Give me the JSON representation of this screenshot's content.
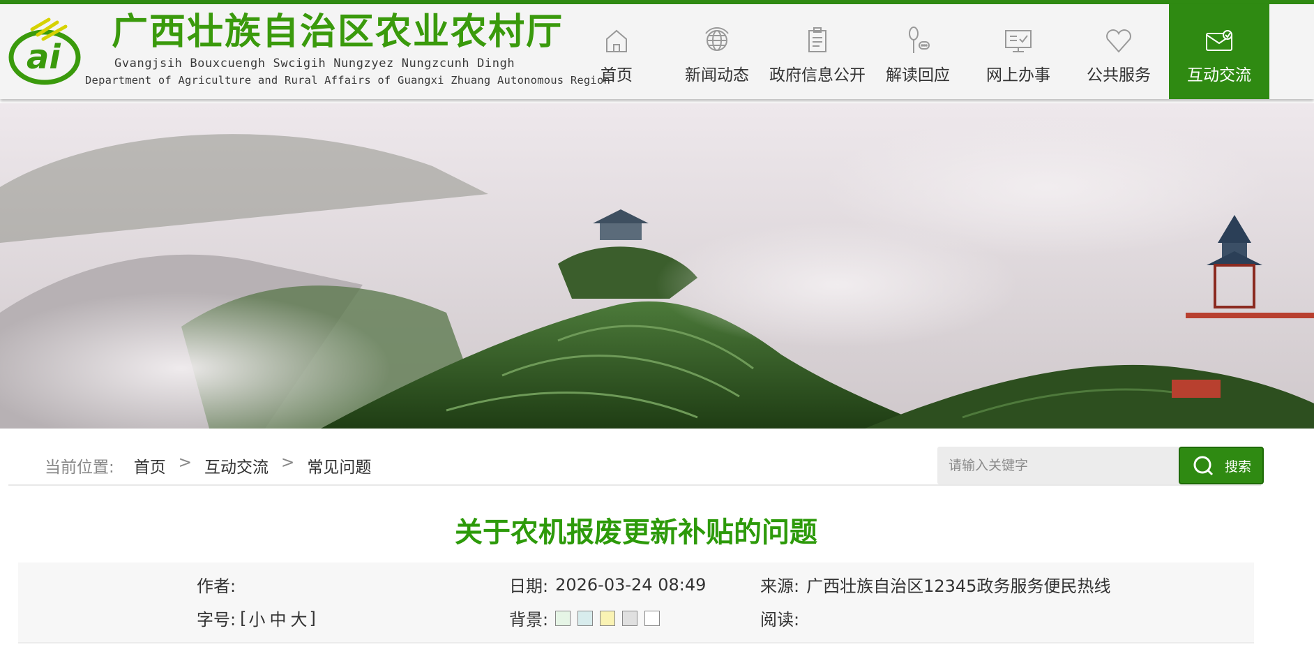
{
  "header": {
    "title": "广西壮族自治区农业农村厅",
    "zhuang_name": "Gvangjsih Bouxcuengh Swcigih Nungzyez Nungzcunh Dingh",
    "english_name": "Department of Agriculture and Rural Affairs of Guangxi Zhuang Autonomous Region",
    "logo_text": "ai",
    "brand_color": "#2f8a12"
  },
  "nav": {
    "items": [
      {
        "label": "首页",
        "icon": "home-icon"
      },
      {
        "label": "新闻动态",
        "icon": "globe-icon"
      },
      {
        "label": "政府信息公开",
        "icon": "clipboard-icon"
      },
      {
        "label": "解读回应",
        "icon": "microphone-chat-icon"
      },
      {
        "label": "网上办事",
        "icon": "monitor-check-icon"
      },
      {
        "label": "公共服务",
        "icon": "heart-icon"
      },
      {
        "label": "互动交流",
        "icon": "envelope-icon",
        "active": true
      }
    ]
  },
  "breadcrumb": {
    "label": "当前位置:",
    "items": [
      "首页",
      "互动交流",
      "常见问题"
    ],
    "separator": ">"
  },
  "search": {
    "placeholder": "请输入关键字",
    "button_label": "搜索"
  },
  "article": {
    "title": "关于农机报废更新补贴的问题",
    "author_label": "作者:",
    "author": "",
    "date_label": "日期:",
    "date": "2026-03-24 08:49",
    "source_label": "来源:",
    "source": "广西壮族自治区12345政务服务便民热线",
    "fontsize_label": "字号:",
    "fontsize_open": "[",
    "fontsize_options": [
      "小",
      "中",
      "大"
    ],
    "fontsize_close": "]",
    "background_label": "背景:",
    "background_colors": [
      "#e6f5e6",
      "#d8eced",
      "#faf3b4",
      "#e0e0e0",
      "#ffffff"
    ],
    "views_label": "阅读:",
    "views": ""
  }
}
